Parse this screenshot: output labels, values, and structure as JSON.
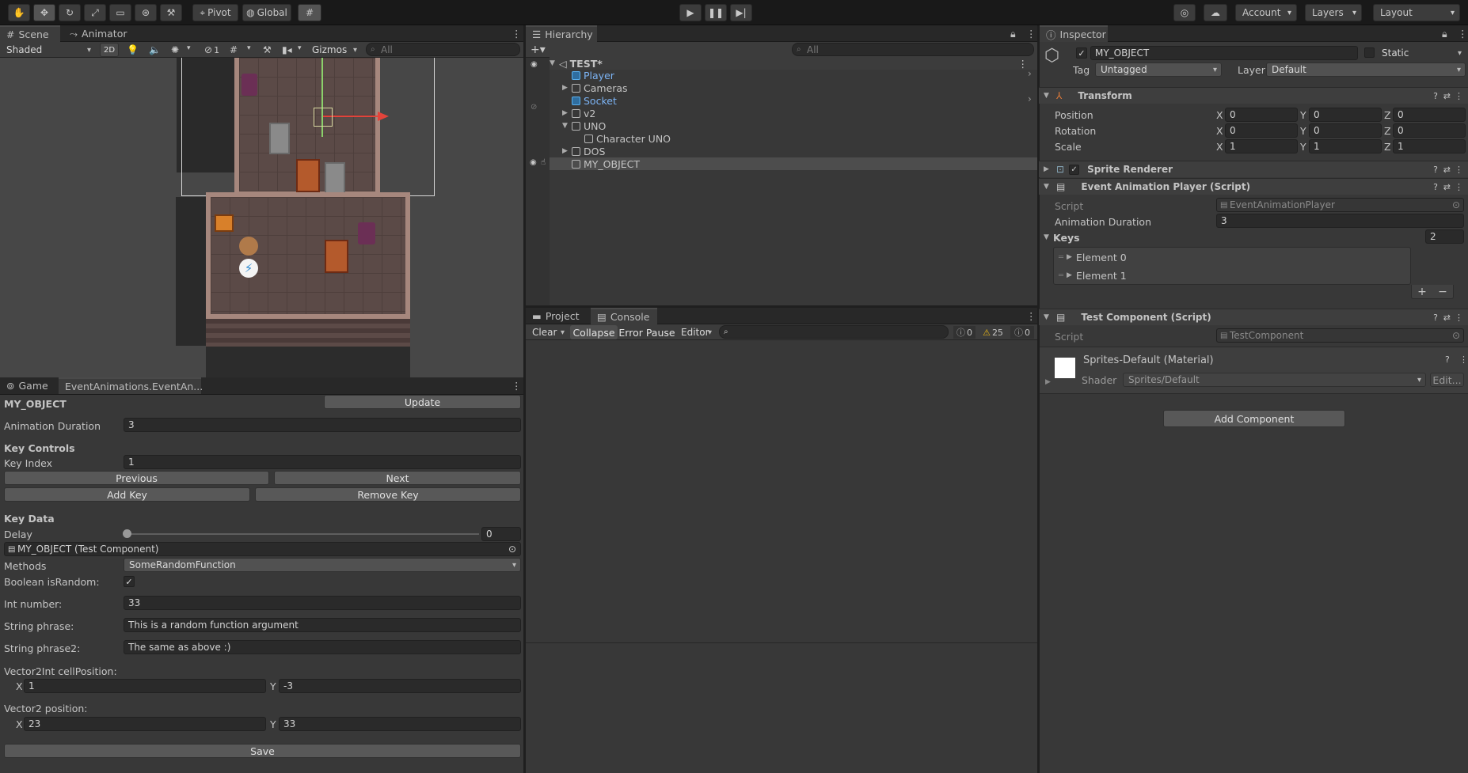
{
  "toolbar": {
    "pivot": "Pivot",
    "global": "Global",
    "account": "Account",
    "layers": "Layers",
    "layout": "Layout"
  },
  "scene": {
    "tab_scene": "Scene",
    "tab_animator": "Animator",
    "shading": "Shaded",
    "mode_2d": "2D",
    "hidden_count": "1",
    "gizmos": "Gizmos",
    "search_placeholder": "All"
  },
  "game": {
    "tab_game": "Game",
    "tab_event": "EventAnimations.EventAn...",
    "object_name": "MY_OBJECT",
    "update_label": "Update",
    "anim_duration_label": "Animation Duration",
    "anim_duration_value": "3",
    "key_controls": "Key Controls",
    "key_index_label": "Key Index",
    "key_index_value": "1",
    "previous": "Previous",
    "next": "Next",
    "add_key": "Add Key",
    "remove_key": "Remove Key",
    "key_data": "Key Data",
    "delay_label": "Delay",
    "delay_value": "0",
    "target": "MY_OBJECT (Test Component)",
    "methods_label": "Methods",
    "methods_value": "SomeRandomFunction",
    "bool_label": "Boolean isRandom:",
    "bool_checked": "✓",
    "int_label": "Int number:",
    "int_value": "33",
    "str_label": "String phrase:",
    "str_value": "This is a random function argument",
    "str2_label": "String phrase2:",
    "str2_value": "The same as above :)",
    "v2i_label": "Vector2Int cellPosition:",
    "v2i_x_label": "X",
    "v2i_x": "1",
    "v2i_y_label": "Y",
    "v2i_y": "-3",
    "v2_label": "Vector2 position:",
    "v2_x_label": "X",
    "v2_x": "23",
    "v2_y_label": "Y",
    "v2_y": "33",
    "save": "Save"
  },
  "hierarchy": {
    "tab": "Hierarchy",
    "search_placeholder": "All",
    "items": [
      {
        "label": "TEST*"
      },
      {
        "label": "Player"
      },
      {
        "label": "Cameras"
      },
      {
        "label": "Socket"
      },
      {
        "label": "v2"
      },
      {
        "label": "UNO"
      },
      {
        "label": "Character UNO"
      },
      {
        "label": "DOS"
      },
      {
        "label": "MY_OBJECT"
      }
    ]
  },
  "console": {
    "tab_project": "Project",
    "tab_console": "Console",
    "clear": "Clear",
    "collapse": "Collapse",
    "error_pause": "Error Pause",
    "editor": "Editor",
    "info_count": "0",
    "warn_count": "25",
    "error_count": "0"
  },
  "inspector": {
    "tab": "Inspector",
    "object_name": "MY_OBJECT",
    "static_label": "Static",
    "tag_label": "Tag",
    "tag_value": "Untagged",
    "layer_label": "Layer",
    "layer_value": "Default",
    "transform": {
      "title": "Transform",
      "rows": [
        {
          "label": "Position",
          "x": "0",
          "y": "0",
          "z": "0"
        },
        {
          "label": "Rotation",
          "x": "0",
          "y": "0",
          "z": "0"
        },
        {
          "label": "Scale",
          "x": "1",
          "y": "1",
          "z": "1"
        }
      ],
      "x": "X",
      "y": "Y",
      "z": "Z"
    },
    "sprite_renderer": "Sprite Renderer",
    "event_player": {
      "title": "Event Animation Player (Script)",
      "script_label": "Script",
      "script_value": "EventAnimationPlayer",
      "anim_label": "Animation Duration",
      "anim_value": "3",
      "keys_label": "Keys",
      "keys_count": "2",
      "elements": [
        "Element 0",
        "Element 1"
      ]
    },
    "test_component": {
      "title": "Test Component (Script)",
      "script_label": "Script",
      "script_value": "TestComponent"
    },
    "material": {
      "title": "Sprites-Default (Material)",
      "shader_label": "Shader",
      "shader_value": "Sprites/Default",
      "edit": "Edit..."
    },
    "add_component": "Add Component"
  },
  "colors": {
    "bg": "#383838",
    "selected_row": "#4d4d4d",
    "blue_text": "#7cb4f5"
  }
}
